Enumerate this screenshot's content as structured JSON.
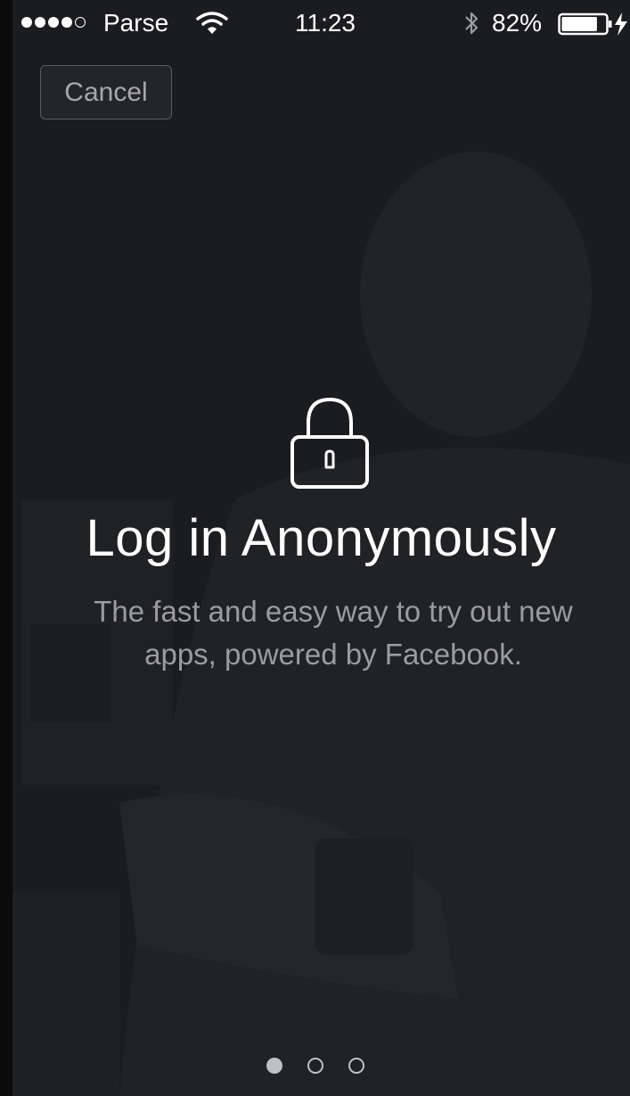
{
  "status_bar": {
    "signal_dots": [
      true,
      true,
      true,
      true,
      false
    ],
    "carrier": "Parse",
    "time": "11:23",
    "bluetooth": "bluetooth-icon",
    "battery_percent": "82%",
    "battery_level": 0.82
  },
  "cancel_label": "Cancel",
  "hero": {
    "icon": "lock-icon",
    "title": "Log in Anonymously",
    "subtitle": "The fast and easy way to try out new apps, powered by Facebook."
  },
  "pagination": {
    "count": 3,
    "active_index": 0
  },
  "colors": {
    "background": "#1a1b1e",
    "text_primary": "#ffffff",
    "text_secondary": "#9b9c9f",
    "top_strip": "#3b5b9a"
  }
}
